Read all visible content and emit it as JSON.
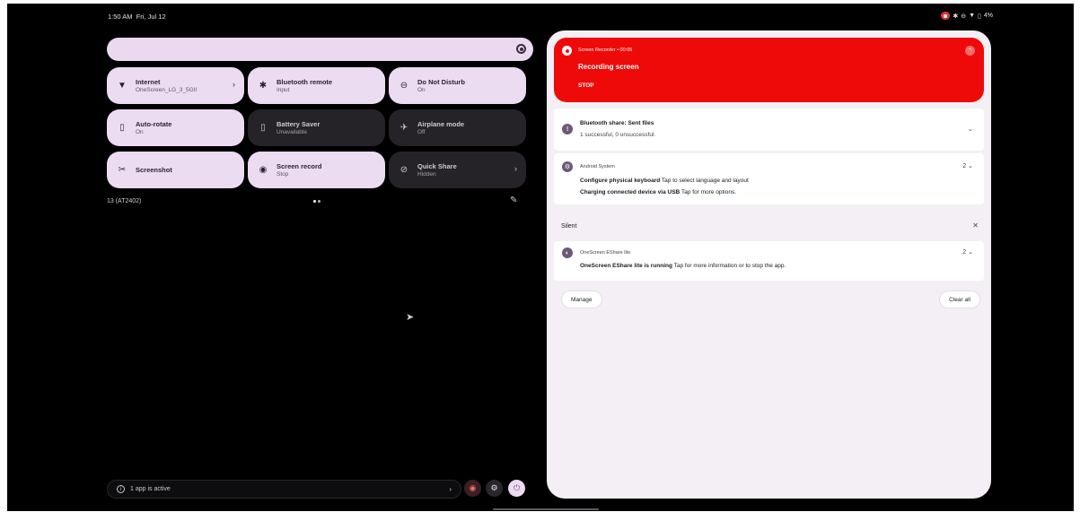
{
  "status_bar": {
    "time": "1:50 AM",
    "date": "Fri, Jul 12",
    "battery": "4%"
  },
  "quick_settings": {
    "tiles": [
      {
        "name": "tile-internet",
        "icon": "wifi-icon",
        "glyph": "▼",
        "label": "Internet",
        "sub": "OneScreen_LG_3_5GII",
        "on": true,
        "chevron": true
      },
      {
        "name": "tile-bluetooth-remote",
        "icon": "bluetooth-icon",
        "glyph": "✱",
        "label": "Bluetooth remote",
        "sub": "Input",
        "on": true
      },
      {
        "name": "tile-do-not-disturb",
        "icon": "do-not-disturb-icon",
        "glyph": "⊖",
        "label": "Do Not Disturb",
        "sub": "On",
        "on": true
      },
      {
        "name": "tile-auto-rotate",
        "icon": "rotate-icon",
        "glyph": "▯",
        "label": "Auto-rotate",
        "sub": "On",
        "on": true
      },
      {
        "name": "tile-battery-saver",
        "icon": "battery-icon",
        "glyph": "▯",
        "label": "Battery Saver",
        "sub": "Unavailable",
        "on": false
      },
      {
        "name": "tile-airplane-mode",
        "icon": "airplane-icon",
        "glyph": "✈",
        "label": "Airplane mode",
        "sub": "Off",
        "on": false
      },
      {
        "name": "tile-screenshot",
        "icon": "screenshot-icon",
        "glyph": "✂",
        "label": "Screenshot",
        "sub": "",
        "on": true
      },
      {
        "name": "tile-screen-record",
        "icon": "screen-record-icon",
        "glyph": "◉",
        "label": "Screen record",
        "sub": "Stop",
        "on": true
      },
      {
        "name": "tile-quick-share",
        "icon": "quick-share-icon",
        "glyph": "⊘",
        "label": "Quick Share",
        "sub": "Hidden",
        "on": false,
        "chevron": true
      }
    ],
    "build": "13 (AT2402)",
    "footer_active": "1 app is active"
  },
  "notifications": {
    "recorder": {
      "header": "Screen Recorder • 00:05",
      "title": "Recording screen",
      "action": "STOP"
    },
    "bluetooth": {
      "title": "Bluetooth share: Sent files",
      "text": "1 successful, 0 unsuccessful."
    },
    "android_system": {
      "app": "Android System",
      "count": "2",
      "line1_bold": "Configure physical keyboard",
      "line1": " Tap to select language and layout",
      "line2_bold": "Charging connected device via USB",
      "line2": " Tap for more options."
    },
    "silent_label": "Silent",
    "eshare": {
      "app": "OneScreen EShare lite",
      "count": "2",
      "bold": "OneScreen EShare lite is running",
      "text": " Tap for more information or to stop the app."
    },
    "manage": "Manage",
    "clear_all": "Clear all"
  }
}
